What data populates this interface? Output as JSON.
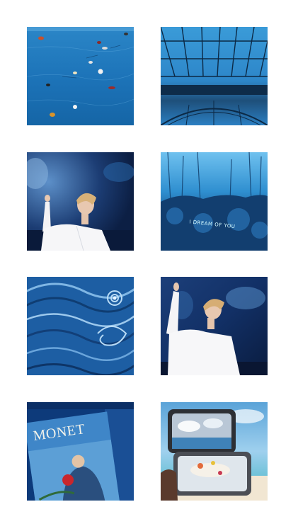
{
  "grid": {
    "tiles": [
      {
        "id": "underwater-petals",
        "caption": ""
      },
      {
        "id": "glass-greenhouse",
        "caption": ""
      },
      {
        "id": "portrait-reaching-1",
        "caption": ""
      },
      {
        "id": "dream-forest",
        "caption": "I DREAM OF YOU"
      },
      {
        "id": "starry-night-detail",
        "caption": ""
      },
      {
        "id": "portrait-reaching-2",
        "caption": ""
      },
      {
        "id": "monet-book",
        "caption": "MONET"
      },
      {
        "id": "sky-tin-box",
        "caption": ""
      }
    ]
  },
  "colors": {
    "background": "#ffffff",
    "accent_blue": "#1f6fb0",
    "deep_blue": "#0b2c57"
  }
}
